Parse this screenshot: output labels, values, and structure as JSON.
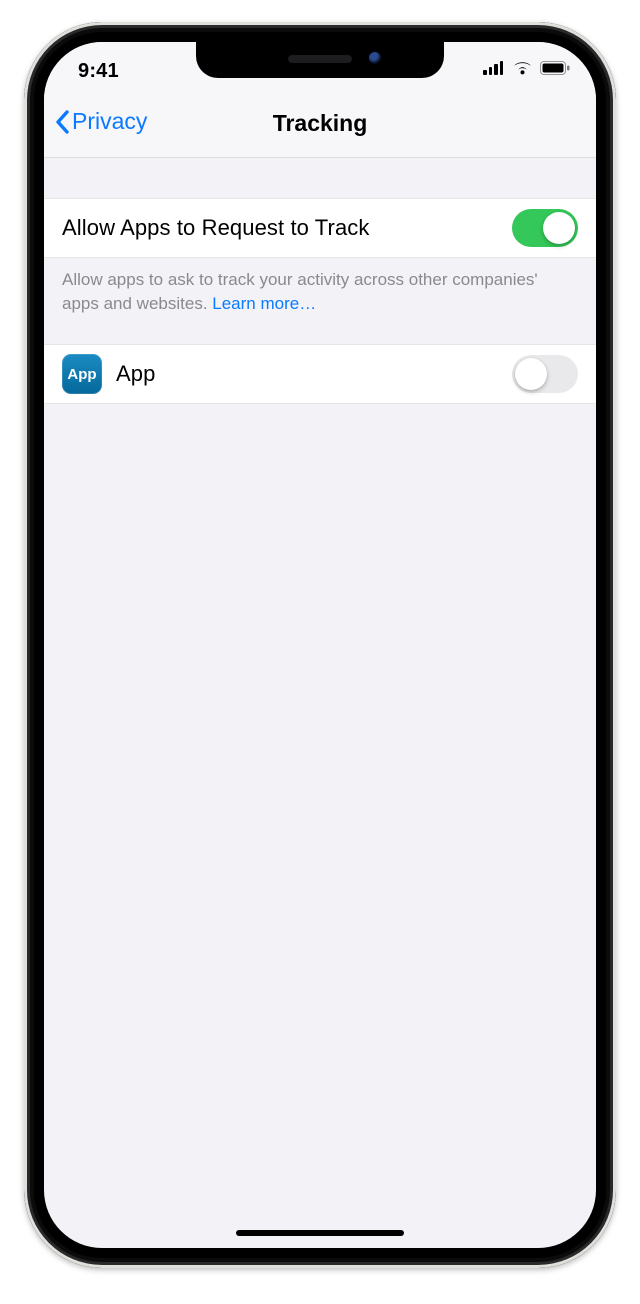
{
  "status": {
    "time": "9:41"
  },
  "nav": {
    "back_label": "Privacy",
    "title": "Tracking"
  },
  "tracking": {
    "allow_label": "Allow Apps to Request to Track",
    "allow_on": true,
    "footer": "Allow apps to ask to track your activity across other companies' apps and websites. ",
    "learn_more": "Learn more…"
  },
  "apps": [
    {
      "icon_text": "App",
      "name": "App",
      "on": false
    }
  ],
  "colors": {
    "tint": "#0a7aff",
    "switch_on": "#34c759"
  }
}
